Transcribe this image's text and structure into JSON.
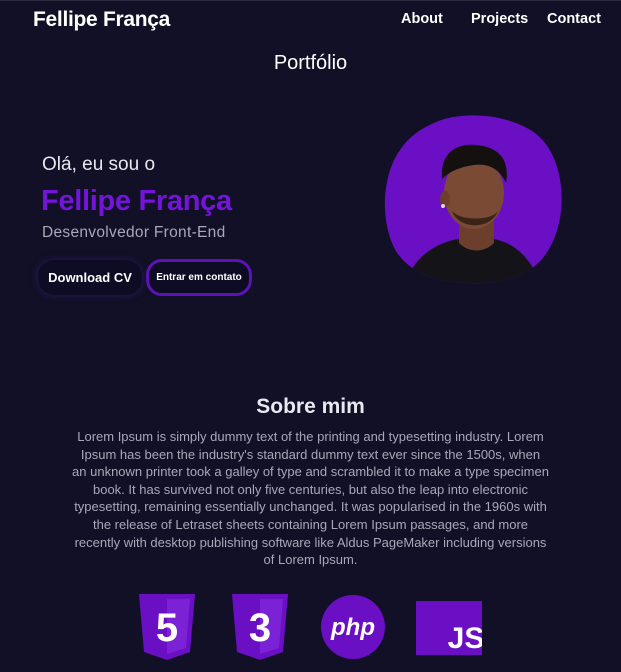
{
  "nav": {
    "logo": "Fellipe França",
    "links": [
      "About",
      "Projects",
      "Contact"
    ]
  },
  "page_title": "Portfólio",
  "hero": {
    "greeting": "Olá, eu sou o",
    "name": "Fellipe França",
    "role": "Desenvolvedor Front-End",
    "download_label": "Download CV",
    "contact_label": "Entrar em contato"
  },
  "about": {
    "title": "Sobre mim",
    "text": "Lorem Ipsum is simply dummy text of the printing and typesetting industry. Lorem Ipsum has been the industry's standard dummy text ever since the 1500s, when an unknown printer took a galley of type and scrambled it to make a type specimen book. It has survived not only five centuries, but also the leap into electronic typesetting, remaining essentially unchanged. It was popularised in the 1960s with the release of Letraset sheets containing Lorem Ipsum passages, and more recently with desktop publishing software like Aldus PageMaker including versions of Lorem Ipsum."
  },
  "skills": [
    {
      "icon": "html5-icon",
      "label": "5"
    },
    {
      "icon": "css3-icon",
      "label": "3"
    },
    {
      "icon": "php-icon",
      "label": "php"
    },
    {
      "icon": "javascript-icon",
      "label": "JS"
    }
  ],
  "colors": {
    "background": "#111026",
    "accent": "#7315d9",
    "muted_text": "#a9a8b8"
  }
}
